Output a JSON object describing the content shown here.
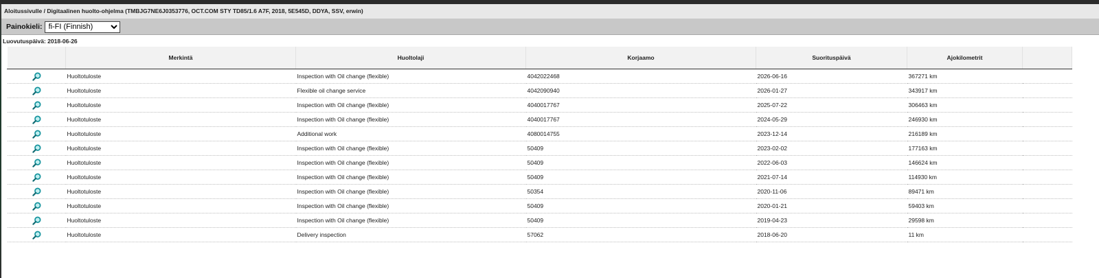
{
  "breadcrumb": "Aloitussivulle / Digitaalinen huolto-ohjelma (TMBJG7NE6J0353776, OCT.COM STY TD85/1.6 A7F, 2018, 5E545D, DDYA, SSV, erwin)",
  "language": {
    "label": "Painokieli:",
    "selected": "fi-FI (Finnish)"
  },
  "delivery_date": "Luovutuspäivä: 2018-06-26",
  "table": {
    "columns": [
      "",
      "Merkintä",
      "Huoltolaji",
      "Korjaamo",
      "Suorituspäivä",
      "Ajokilometrit",
      ""
    ],
    "rows": [
      {
        "icon": "magnifier-icon",
        "entry": "Huoltotuloste",
        "service": "Inspection with Oil change (flexible)",
        "workshop": "4042022468",
        "date": "2026-06-16",
        "km": "367271 km"
      },
      {
        "icon": "magnifier-icon",
        "entry": "Huoltotuloste",
        "service": "Flexible oil change service",
        "workshop": "4042090940",
        "date": "2026-01-27",
        "km": "343917 km"
      },
      {
        "icon": "magnifier-icon",
        "entry": "Huoltotuloste",
        "service": "Inspection with Oil change (flexible)",
        "workshop": "4040017767",
        "date": "2025-07-22",
        "km": "306463 km"
      },
      {
        "icon": "magnifier-icon",
        "entry": "Huoltotuloste",
        "service": "Inspection with Oil change (flexible)",
        "workshop": "4040017767",
        "date": "2024-05-29",
        "km": "246930 km"
      },
      {
        "icon": "magnifier-icon",
        "entry": "Huoltotuloste",
        "service": "Additional work",
        "workshop": "4080014755",
        "date": "2023-12-14",
        "km": "216189 km"
      },
      {
        "icon": "magnifier-icon",
        "entry": "Huoltotuloste",
        "service": "Inspection with Oil change (flexible)",
        "workshop": "50409",
        "date": "2023-02-02",
        "km": "177163 km"
      },
      {
        "icon": "magnifier-icon",
        "entry": "Huoltotuloste",
        "service": "Inspection with Oil change (flexible)",
        "workshop": "50409",
        "date": "2022-06-03",
        "km": "146624 km"
      },
      {
        "icon": "magnifier-icon",
        "entry": "Huoltotuloste",
        "service": "Inspection with Oil change (flexible)",
        "workshop": "50409",
        "date": "2021-07-14",
        "km": "114930 km"
      },
      {
        "icon": "magnifier-icon",
        "entry": "Huoltotuloste",
        "service": "Inspection with Oil change (flexible)",
        "workshop": "50354",
        "date": "2020-11-06",
        "km": "89471 km"
      },
      {
        "icon": "magnifier-icon",
        "entry": "Huoltotuloste",
        "service": "Inspection with Oil change (flexible)",
        "workshop": "50409",
        "date": "2020-01-21",
        "km": "59403 km"
      },
      {
        "icon": "magnifier-icon",
        "entry": "Huoltotuloste",
        "service": "Inspection with Oil change (flexible)",
        "workshop": "50409",
        "date": "2019-04-23",
        "km": "29598 km"
      },
      {
        "icon": "magnifier-icon",
        "entry": "Huoltotuloste",
        "service": "Delivery inspection",
        "workshop": "57062",
        "date": "2018-06-20",
        "km": "11 km"
      }
    ]
  },
  "colors": {
    "header_bg": "#f2f2f2",
    "lang_bar_bg": "#c8c8c8",
    "icon_teal": "#1a9aa4"
  }
}
